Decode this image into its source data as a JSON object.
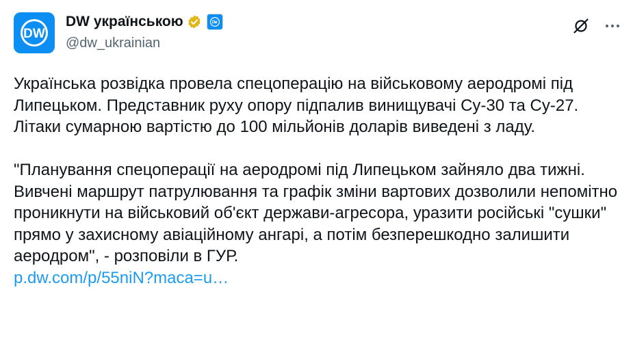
{
  "author": {
    "name": "DW українською",
    "handle": "@dw_ukrainian",
    "avatar_text": "DW"
  },
  "colors": {
    "brand": "#0c8ef2",
    "link": "#1d9bf0",
    "verified_gold": "#e2b719",
    "text": "#0f1419",
    "secondary": "#536471"
  },
  "icons": {
    "verified": "verified-badge-icon",
    "affiliate": "dw-affiliate-icon",
    "grok": "grok-icon",
    "more": "more-icon"
  },
  "tweet": {
    "paragraph1": "Українська розвідка провела спецоперацію на військовому аеродромі під Липецьком. Представник руху опору підпалив винищувачі Су-30 та Су-27. Літаки сумарною вартістю до 100 мільйонів доларів виведені з ладу.",
    "paragraph2": "\"Планування спецоперації на аеродромі під Липецьком зайняло два тижні. Вивчені маршрут патрулювання та графік зміни вартових дозволили непомітно проникнути на військовий об'єкт держави-агресора, уразити російські \"сушки\" прямо у захисному авіаційному ангарі, а потім безперешкодно залишити аеродром\", - розповіли в ГУР.",
    "link": "p.dw.com/p/55niN?maca=u…"
  }
}
